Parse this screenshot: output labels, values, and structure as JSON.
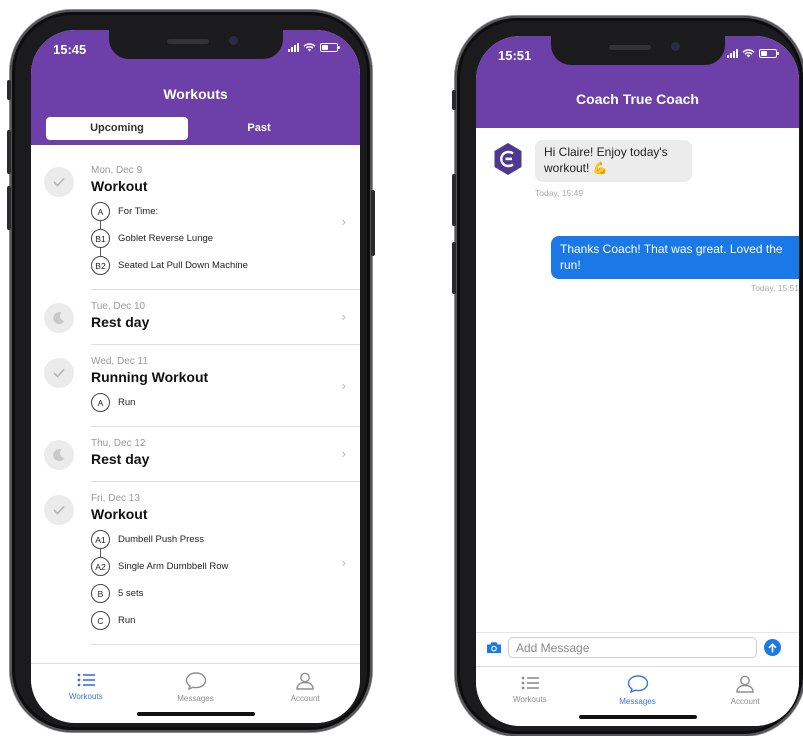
{
  "colors": {
    "brand_purple": "#6d3fa8",
    "accent_blue": "#1a79e6",
    "tab_active": "#3b73e6",
    "muted_grey": "#8e8e93"
  },
  "left_phone": {
    "status_time": "15:45",
    "title": "Workouts",
    "segments": [
      {
        "label": "Upcoming",
        "active": true
      },
      {
        "label": "Past",
        "active": false
      }
    ],
    "days": [
      {
        "date": "Mon, Dec 9",
        "title": "Workout",
        "icon": "check-icon",
        "exercises": [
          {
            "badge": "A",
            "name": "For Time:"
          },
          {
            "badge": "B1",
            "name": "Goblet Reverse Lunge"
          },
          {
            "badge": "B2",
            "name": "Seated Lat Pull Down Machine"
          }
        ]
      },
      {
        "date": "Tue, Dec 10",
        "title": "Rest day",
        "icon": "moon-icon",
        "exercises": []
      },
      {
        "date": "Wed, Dec 11",
        "title": "Running Workout",
        "icon": "check-icon",
        "exercises": [
          {
            "badge": "A",
            "name": "Run"
          }
        ]
      },
      {
        "date": "Thu, Dec 12",
        "title": "Rest day",
        "icon": "moon-icon",
        "exercises": []
      },
      {
        "date": "Fri, Dec 13",
        "title": "Workout",
        "icon": "check-icon",
        "exercises": [
          {
            "badge": "A1",
            "name": "Dumbell Push Press"
          },
          {
            "badge": "A2",
            "name": "Single Arm Dumbbell Row"
          },
          {
            "badge": "B",
            "name": "5 sets"
          },
          {
            "badge": "C",
            "name": "Run"
          }
        ]
      }
    ],
    "tabbar": [
      {
        "label": "Workouts",
        "icon": "list-icon",
        "active": true
      },
      {
        "label": "Messages",
        "icon": "chat-bubble-icon",
        "active": false
      },
      {
        "label": "Account",
        "icon": "user-icon",
        "active": false
      }
    ]
  },
  "right_phone": {
    "status_time": "15:51",
    "title": "Coach True Coach",
    "messages": {
      "incoming": {
        "text": "Hi Claire! Enjoy today's workout! 💪",
        "timestamp": "Today, 15:49"
      },
      "outgoing": {
        "text": "Thanks Coach! That was great. Loved the run!",
        "timestamp": "Today, 15:51"
      }
    },
    "input": {
      "placeholder": "Add Message"
    },
    "tabbar": [
      {
        "label": "Workouts",
        "icon": "list-icon",
        "active": false
      },
      {
        "label": "Messages",
        "icon": "chat-bubble-icon",
        "active": true
      },
      {
        "label": "Account",
        "icon": "user-icon",
        "active": false
      }
    ]
  }
}
